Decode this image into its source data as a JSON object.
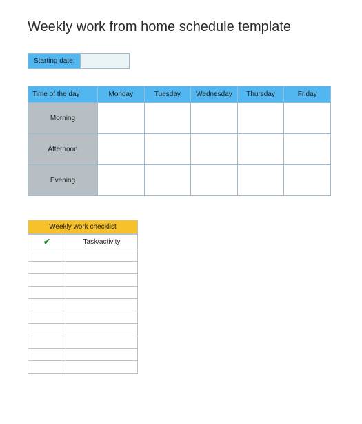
{
  "title": "Weekly work from home schedule template",
  "starting_date": {
    "label": "Starting date:",
    "value": ""
  },
  "schedule": {
    "time_header": "Time of the day",
    "days": [
      "Monday",
      "Tuesday",
      "Wednesday",
      "Thursday",
      "Friday"
    ],
    "rows": [
      {
        "label": "Morning",
        "cells": [
          "",
          "",
          "",
          "",
          ""
        ]
      },
      {
        "label": "Afternoon",
        "cells": [
          "",
          "",
          "",
          "",
          ""
        ]
      },
      {
        "label": "Evening",
        "cells": [
          "",
          "",
          "",
          "",
          ""
        ]
      }
    ]
  },
  "checklist": {
    "title": "Weekly work checklist",
    "check_icon": "✔",
    "task_header": "Task/activity",
    "rows": [
      {
        "done": "",
        "task": ""
      },
      {
        "done": "",
        "task": ""
      },
      {
        "done": "",
        "task": ""
      },
      {
        "done": "",
        "task": ""
      },
      {
        "done": "",
        "task": ""
      },
      {
        "done": "",
        "task": ""
      },
      {
        "done": "",
        "task": ""
      },
      {
        "done": "",
        "task": ""
      },
      {
        "done": "",
        "task": ""
      },
      {
        "done": "",
        "task": ""
      }
    ]
  },
  "colors": {
    "header_blue": "#52b7f0",
    "row_grey": "#b8bfc4",
    "checklist_yellow": "#f6c12b"
  }
}
